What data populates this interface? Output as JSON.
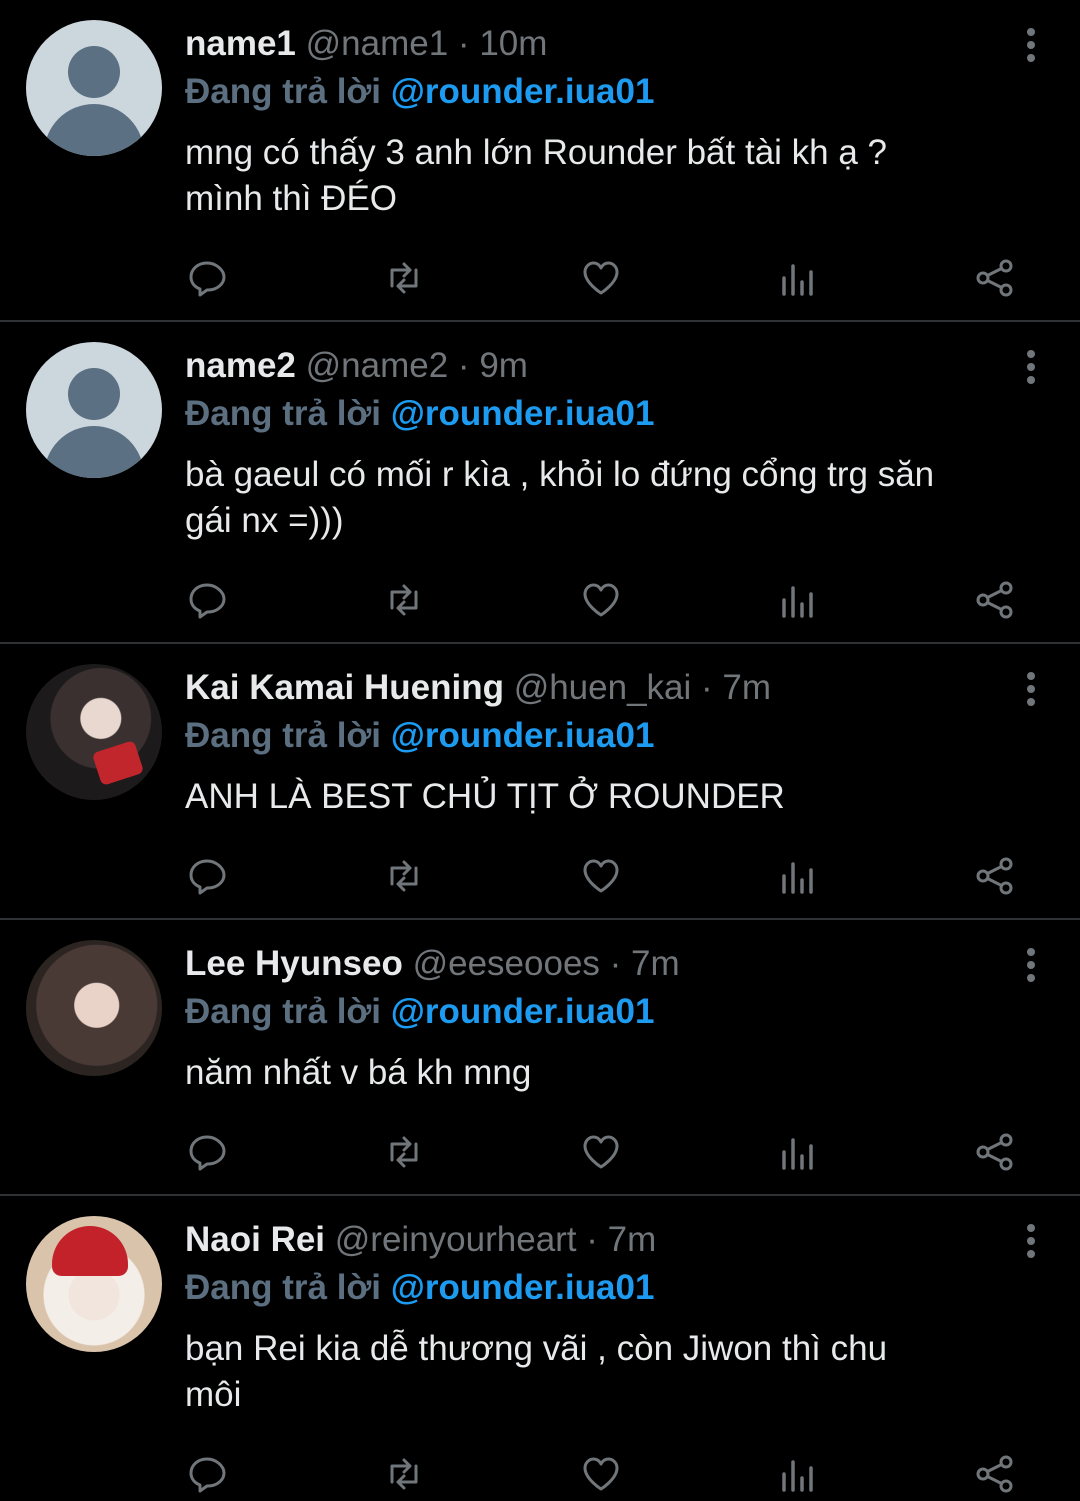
{
  "tweets": [
    {
      "name": "name1",
      "handle": "@name1",
      "dot": "·",
      "time": "10m",
      "reply_prefix": "Đang trả lời",
      "reply_handle": "@rounder.iua01",
      "text_line1": "mng có thấy 3 anh lớn Rounder bất tài kh ạ ?",
      "text_line2": "mình thì ĐÉO"
    },
    {
      "name": "name2",
      "handle": "@name2",
      "dot": "·",
      "time": "9m",
      "reply_prefix": "Đang trả lời",
      "reply_handle": "@rounder.iua01",
      "text_line1": "bà gaeul có mối r kìa , khỏi lo đứng cổng trg săn",
      "text_line2": "gái nx =)))"
    },
    {
      "name": "Kai Kamai Huening",
      "handle": "@huen_kai",
      "dot": "·",
      "time": "7m",
      "reply_prefix": "Đang trả lời",
      "reply_handle": "@rounder.iua01",
      "text_line1": "ANH LÀ BEST CHỦ TỊT Ở ROUNDER",
      "text_line2": ""
    },
    {
      "name": "Lee Hyunseo",
      "handle": "@eeseooes",
      "dot": "·",
      "time": "7m",
      "reply_prefix": "Đang trả lời",
      "reply_handle": "@rounder.iua01",
      "text_line1": "năm nhất v bá kh mng",
      "text_line2": ""
    },
    {
      "name": "Naoi Rei",
      "handle": "@reinyourheart",
      "dot": "·",
      "time": "7m",
      "reply_prefix": "Đang trả lời",
      "reply_handle": "@rounder.iua01",
      "text_line1": "bạn Rei kia dễ thương vãi , còn Jiwon thì chu",
      "text_line2": "môi"
    }
  ],
  "icons": {
    "reply": "reply-icon",
    "retweet": "retweet-icon",
    "like": "heart-icon",
    "views": "views-icon",
    "share": "share-icon",
    "more": "more-vertical-icon"
  },
  "colors": {
    "background": "#000000",
    "accent": "#1d9bf0",
    "muted": "#71767b",
    "text": "#e7e9ea",
    "divider": "#2f3336"
  }
}
